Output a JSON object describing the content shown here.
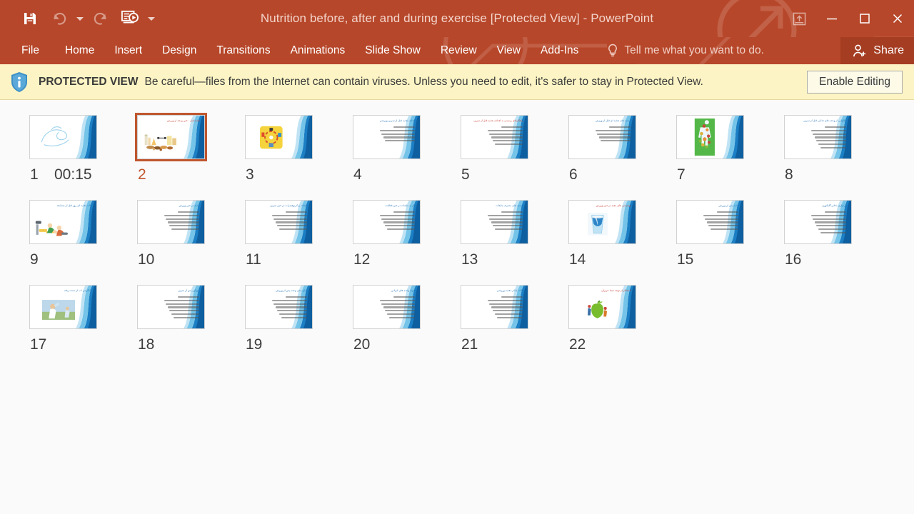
{
  "window": {
    "title": "Nutrition before, after and during exercise [Protected View] - PowerPoint",
    "quick_access": [
      {
        "name": "save",
        "label": "Save",
        "enabled": true
      },
      {
        "name": "undo",
        "label": "Undo",
        "enabled": false
      },
      {
        "name": "redo",
        "label": "Redo",
        "enabled": false
      },
      {
        "name": "start-from-beginning",
        "label": "Start From Beginning",
        "enabled": true
      }
    ],
    "qat_customize_label": "Customize Quick Access Toolbar",
    "controls": {
      "ribbon_display_options": "Ribbon Display Options",
      "minimize": "Minimize",
      "restore": "Restore Down",
      "close": "Close"
    },
    "accent_color": "#b7472a",
    "share_accent_color": "#a53d22"
  },
  "ribbon": {
    "tabs": [
      {
        "label": "File",
        "active": false
      },
      {
        "label": "Home",
        "active": false
      },
      {
        "label": "Insert",
        "active": false
      },
      {
        "label": "Design",
        "active": false
      },
      {
        "label": "Transitions",
        "active": false
      },
      {
        "label": "Animations",
        "active": false
      },
      {
        "label": "Slide Show",
        "active": false
      },
      {
        "label": "Review",
        "active": false
      },
      {
        "label": "View",
        "active": false
      },
      {
        "label": "Add-Ins",
        "active": false
      }
    ],
    "tell_me": "Tell me what you want to do.",
    "share": "Share"
  },
  "protected_view": {
    "title": "PROTECTED VIEW",
    "message": "Be careful—files from the Internet can contain viruses. Unless you need to edit, it's safer to stay in Protected View.",
    "enable_button": "Enable Editing",
    "background_color": "#fcf4c4"
  },
  "slide_sorter": {
    "selected_slide": 2,
    "slides": [
      {
        "number": "1",
        "timing": "00:15",
        "selected": false,
        "title": "",
        "title_color": "blue",
        "lines": 0,
        "art": "title-script"
      },
      {
        "number": "2",
        "timing": "",
        "selected": true,
        "title": "تغذیه قبل ، حین و بعد از ورزش",
        "title_color": "red",
        "lines": 0,
        "art": "food-weights"
      },
      {
        "number": "3",
        "timing": "",
        "selected": false,
        "title": "",
        "title_color": "blue",
        "lines": 0,
        "art": "yellow-cycle"
      },
      {
        "number": "4",
        "timing": "",
        "selected": false,
        "title": "اهداف تغذیه قبل از تمرین ورزشی",
        "title_color": "blue",
        "lines": 5,
        "art": "none"
      },
      {
        "number": "5",
        "timing": "",
        "selected": false,
        "title": "راهکارهای رسیدن به اهداف تغذیه قبل از تمرین",
        "title_color": "red",
        "lines": 6,
        "art": "none"
      },
      {
        "number": "6",
        "timing": "",
        "selected": false,
        "title": "توصیه های تغذیه ای قبل از ورزش",
        "title_color": "blue",
        "lines": 5,
        "art": "none"
      },
      {
        "number": "7",
        "timing": "",
        "selected": false,
        "title": "",
        "title_color": "blue",
        "lines": 0,
        "art": "green-body"
      },
      {
        "number": "8",
        "timing": "",
        "selected": false,
        "title": "مثالهایی از وعده های غذایی قبل از تمرین",
        "title_color": "blue",
        "lines": 7,
        "art": "none"
      },
      {
        "number": "9",
        "timing": "",
        "selected": false,
        "title": "نکات تغذیه ای روز قبل از مسابقه",
        "title_color": "blue",
        "lines": 0,
        "art": "cartoon-exercise"
      },
      {
        "number": "10",
        "timing": "",
        "selected": false,
        "title": "تغذیه در حین ورزش",
        "title_color": "blue",
        "lines": 6,
        "art": "none"
      },
      {
        "number": "11",
        "timing": "",
        "selected": false,
        "title": "مایعات و کربوهیدرات در حین تمرین",
        "title_color": "blue",
        "lines": 6,
        "art": "none"
      },
      {
        "number": "12",
        "timing": "",
        "selected": false,
        "title": "نیاز به مایعات در حین فعالیت",
        "title_color": "blue",
        "lines": 6,
        "art": "none"
      },
      {
        "number": "13",
        "timing": "",
        "selected": false,
        "title": "توصیه های مصرف مایعات",
        "title_color": "blue",
        "lines": 6,
        "art": "none"
      },
      {
        "number": "14",
        "timing": "",
        "selected": false,
        "title": "نوشیدنی های مفید در حین ورزش",
        "title_color": "red",
        "lines": 0,
        "art": "water-glass"
      },
      {
        "number": "15",
        "timing": "",
        "selected": false,
        "title": "تغذیه پس از ورزش",
        "title_color": "blue",
        "lines": 6,
        "art": "none"
      },
      {
        "number": "16",
        "timing": "",
        "selected": false,
        "title": "بازسازی ذخایر گلیکوژن",
        "title_color": "blue",
        "lines": 7,
        "art": "none"
      },
      {
        "number": "17",
        "timing": "",
        "selected": false,
        "title": "جایگزینی آب از دست رفته",
        "title_color": "blue",
        "lines": 0,
        "art": "drinking-water"
      },
      {
        "number": "18",
        "timing": "",
        "selected": false,
        "title": "پروتئین پس از تمرین",
        "title_color": "blue",
        "lines": 7,
        "art": "none"
      },
      {
        "number": "19",
        "timing": "",
        "selected": false,
        "title": "زمان بندی وعده پس از ورزش",
        "title_color": "blue",
        "lines": 7,
        "art": "none"
      },
      {
        "number": "20",
        "timing": "",
        "selected": false,
        "title": "نمونه وعده های بازیابی",
        "title_color": "blue",
        "lines": 7,
        "art": "none"
      },
      {
        "number": "21",
        "timing": "",
        "selected": false,
        "title": "نکات پایانی تغذیه ورزشی",
        "title_color": "blue",
        "lines": 7,
        "art": "none"
      },
      {
        "number": "22",
        "timing": "",
        "selected": false,
        "title": "با تشکر از توجه شما عزیزان",
        "title_color": "red",
        "lines": 0,
        "art": "green-apple"
      }
    ]
  }
}
